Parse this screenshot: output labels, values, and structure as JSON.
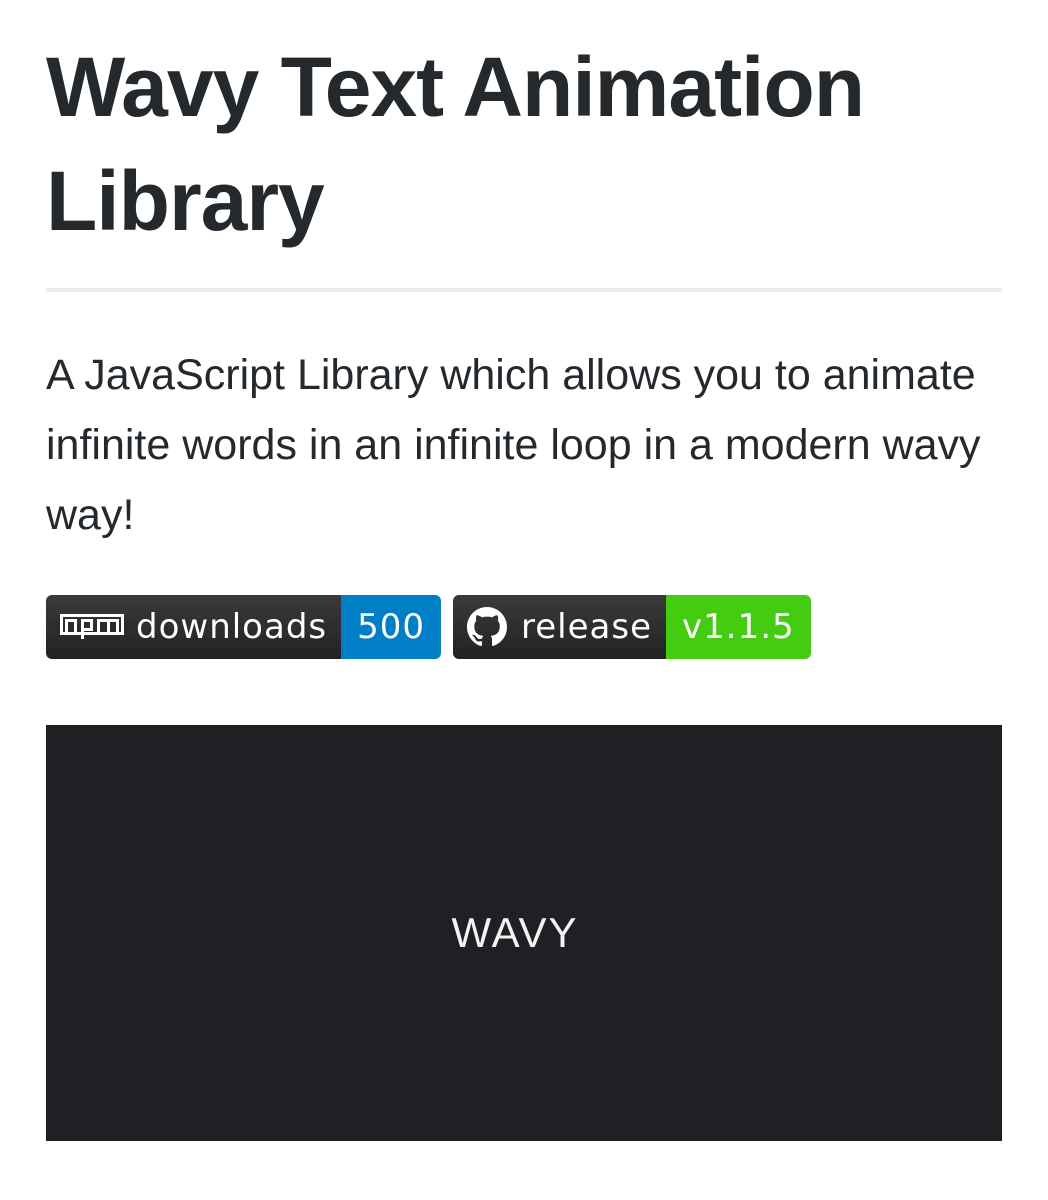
{
  "page": {
    "title": "Wavy Text Animation Library",
    "description": "A JavaScript Library which allows you to animate infinite words in an infinite loop in a modern wavy way!"
  },
  "badges": [
    {
      "icon": "npm-icon",
      "label": "downloads",
      "value": "500",
      "value_color": "#007ec6"
    },
    {
      "icon": "github-icon",
      "label": "release",
      "value": "v1.1.5",
      "value_color": "#4c1"
    }
  ],
  "demo": {
    "word": "WAVY",
    "background": "#1f2024"
  }
}
